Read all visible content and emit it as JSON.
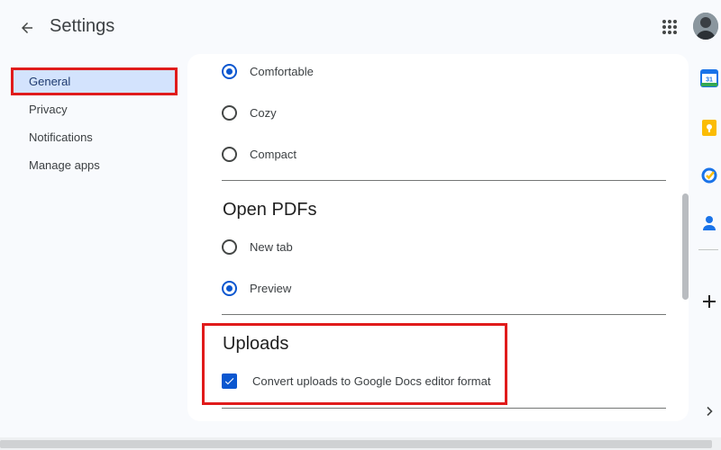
{
  "header": {
    "title": "Settings",
    "back_icon": "arrow-left-icon",
    "apps_icon": "apps-grid-icon"
  },
  "nav": {
    "items": [
      {
        "label": "General",
        "active": true
      },
      {
        "label": "Privacy",
        "active": false
      },
      {
        "label": "Notifications",
        "active": false
      },
      {
        "label": "Manage apps",
        "active": false
      }
    ]
  },
  "density": {
    "options": [
      {
        "label": "Comfortable",
        "selected": true
      },
      {
        "label": "Cozy",
        "selected": false
      },
      {
        "label": "Compact",
        "selected": false
      }
    ]
  },
  "open_pdfs": {
    "title": "Open PDFs",
    "options": [
      {
        "label": "New tab",
        "selected": false
      },
      {
        "label": "Preview",
        "selected": true
      }
    ]
  },
  "uploads": {
    "title": "Uploads",
    "convert_label": "Convert uploads to Google Docs editor format",
    "convert_checked": true
  },
  "side_panel": {
    "calendar_day": "31",
    "icons": [
      "calendar-icon",
      "keep-icon",
      "tasks-icon",
      "contacts-icon",
      "add-icon",
      "chevron-right-icon"
    ]
  },
  "colors": {
    "accent": "#0b57d0",
    "highlight": "#e01b1b",
    "active_nav_bg": "#d3e3fd"
  }
}
